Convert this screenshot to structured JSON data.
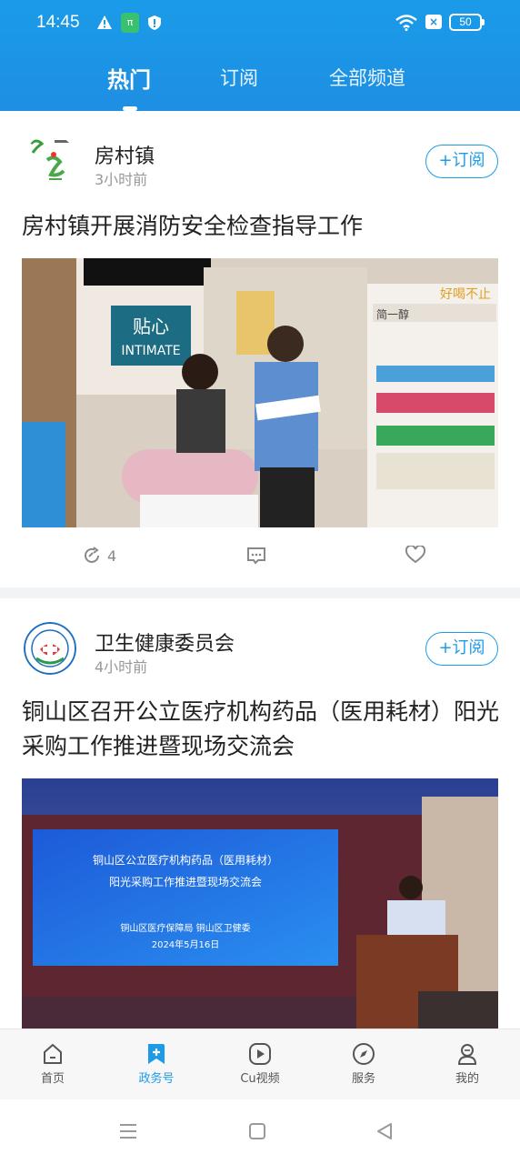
{
  "status_bar": {
    "time": "14:45",
    "battery": "50",
    "icons": [
      "warning-icon",
      "app-notification-icon",
      "shield-icon",
      "wifi-icon",
      "sim-x-icon",
      "battery-icon"
    ]
  },
  "top_tabs": [
    {
      "label": "热门",
      "active": true
    },
    {
      "label": "订阅",
      "active": false
    },
    {
      "label": "全部频道",
      "active": false
    }
  ],
  "feed": [
    {
      "source": "房村镇",
      "time": "3小时前",
      "subscribe_label": "+订阅",
      "title": "房村镇开展消防安全检查指导工作",
      "photo_text": {
        "sign1": "贴心",
        "sign2": "INTIMATE",
        "sign3": "简一醇",
        "sign4": "好喝不止"
      },
      "actions": {
        "repost_count": "4"
      }
    },
    {
      "source": "卫生健康委员会",
      "time": "4小时前",
      "subscribe_label": "+订阅",
      "title": "铜山区召开公立医疗机构药品（医用耗材）阳光采购工作推进暨现场交流会",
      "photo_text": {
        "screen_line1": "铜山区公立医疗机构药品（医用耗材）",
        "screen_line2": "阳光采购工作推进暨现场交流会",
        "screen_line3": "铜山区医疗保障局  铜山区卫健委",
        "screen_line4": "2024年5月16日"
      }
    }
  ],
  "bottom_nav": [
    {
      "label": "首页",
      "icon": "home-icon",
      "active": false
    },
    {
      "label": "政务号",
      "icon": "bookmark-plus-icon",
      "active": true
    },
    {
      "label": "Cu视频",
      "icon": "play-icon",
      "active": false
    },
    {
      "label": "服务",
      "icon": "compass-icon",
      "active": false
    },
    {
      "label": "我的",
      "icon": "profile-icon",
      "active": false
    }
  ],
  "colors": {
    "accent": "#1e9be6",
    "header": "#1a9be8"
  }
}
